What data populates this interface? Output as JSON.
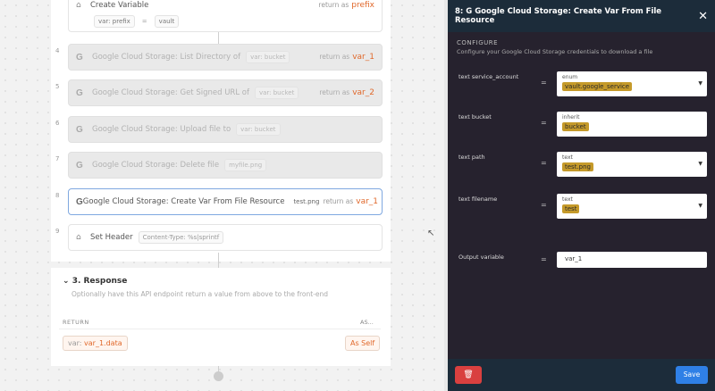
{
  "stack": {
    "first": {
      "title": "Create Variable",
      "var": "var: prefix",
      "eq": "=",
      "value": "vault",
      "return_as": "return as",
      "return_var": "prefix"
    },
    "steps": [
      {
        "num": "4",
        "title": "Google Cloud Storage: List Directory of",
        "pill": "var: bucket",
        "return_as": "return as",
        "return_var": "var_1"
      },
      {
        "num": "5",
        "title": "Google Cloud Storage: Get Signed URL of",
        "pill": "var: bucket",
        "return_as": "return as",
        "return_var": "var_2"
      },
      {
        "num": "6",
        "title": "Google Cloud Storage: Upload file to",
        "pill": "var: bucket"
      },
      {
        "num": "7",
        "title": "Google Cloud Storage: Delete file",
        "pill": "myfile.png"
      },
      {
        "num": "8",
        "title": "Google Cloud Storage: Create Var From File Resource",
        "pill": "test.png",
        "return_as": "return as",
        "return_var": "var_1"
      },
      {
        "num": "9",
        "title": "Set Header",
        "pill": "Content-Type: %s|sprintf"
      }
    ]
  },
  "response": {
    "heading": "3. Response",
    "subtitle": "Optionally have this API endpoint return a value from above to the front-end",
    "return_label": "RETURN",
    "as_label": "AS...",
    "return_prefix": "var:",
    "return_value": "var_1.data",
    "as_value": "As Self"
  },
  "side": {
    "title": "8: G  Google Cloud Storage: Create Var From File Resource",
    "section": "CONFIGURE",
    "section_sub": "Configure your Google Cloud Storage credentials to download a file",
    "fields": [
      {
        "label": "text service_account",
        "sym": "=",
        "type": "enum",
        "value": "vault.google_service"
      },
      {
        "label": "text bucket",
        "sym": "=",
        "type": "inherit",
        "value": "bucket"
      },
      {
        "label": "text path",
        "sym": "=",
        "type": "text",
        "value": "test.png"
      },
      {
        "label": "text filename",
        "sym": "=",
        "type": "text",
        "value": "test"
      }
    ],
    "output": {
      "label": "Output variable",
      "sym": "=",
      "value": "var_1"
    },
    "delete_label": "🗑",
    "save_label": "Save",
    "close_label": "✕"
  }
}
